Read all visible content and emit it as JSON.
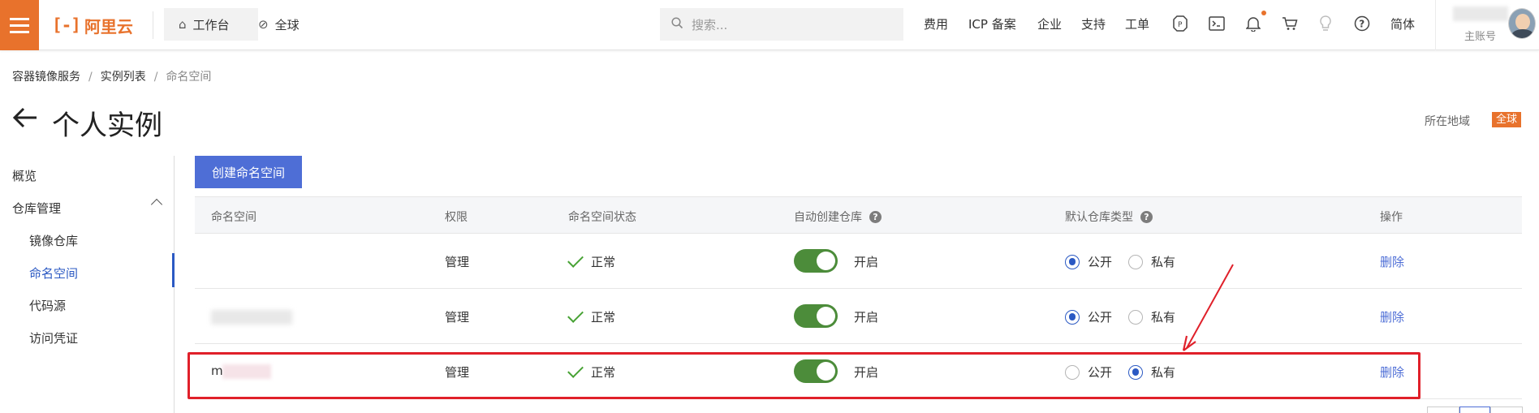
{
  "topbar": {
    "logo_text": "阿里云",
    "logo_mark": "[-]",
    "nav_home": "工作台",
    "nav_global": "全球",
    "search_placeholder": "搜索...",
    "links": [
      "费用",
      "ICP 备案",
      "企业",
      "支持",
      "工单"
    ],
    "icons": [
      "resource-icon",
      "terminal-icon",
      "bell-icon",
      "cart-icon",
      "lightbulb-icon",
      "help-icon"
    ],
    "lang": "简体",
    "account_label": "主账号",
    "accent_color": "#e8722c"
  },
  "breadcrumb": {
    "items": [
      "容器镜像服务",
      "实例列表",
      "命名空间"
    ]
  },
  "page": {
    "title": "个人实例",
    "region_label": "所在地域",
    "region_value": "全球"
  },
  "sidebar": {
    "overview": "概览",
    "repo_group": "仓库管理",
    "sub_items": [
      "镜像仓库",
      "命名空间",
      "代码源",
      "访问凭证"
    ],
    "active": "命名空间"
  },
  "toolbar": {
    "create_label": "创建命名空间"
  },
  "table": {
    "headers": [
      "命名空间",
      "权限",
      "命名空间状态",
      "自动创建仓库",
      "默认仓库类型",
      "操作"
    ],
    "rows": [
      {
        "namespace": "",
        "permission": "管理",
        "status": "正常",
        "auto_create": "开启",
        "public_label": "公开",
        "private_label": "私有",
        "selected": "公开",
        "action": "删除"
      },
      {
        "namespace": "",
        "permission": "管理",
        "status": "正常",
        "auto_create": "开启",
        "public_label": "公开",
        "private_label": "私有",
        "selected": "公开",
        "action": "删除"
      },
      {
        "namespace": "m",
        "permission": "管理",
        "status": "正常",
        "auto_create": "开启",
        "public_label": "公开",
        "private_label": "私有",
        "selected": "私有",
        "action": "删除"
      }
    ]
  }
}
